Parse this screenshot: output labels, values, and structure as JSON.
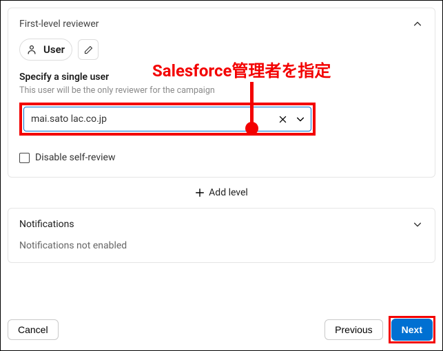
{
  "annotation": {
    "text": "Salesforce管理者を指定"
  },
  "reviewer_panel": {
    "title": "First-level reviewer",
    "pill_label": "User",
    "field_label": "Specify a single user",
    "field_help": "This user will be the only reviewer for the campaign",
    "selected_user": "mai.sato lac.co.jp",
    "disable_self_review_label": "Disable self-review"
  },
  "add_level_label": "Add level",
  "notifications": {
    "title": "Notifications",
    "status": "Notifications not enabled"
  },
  "footer": {
    "cancel": "Cancel",
    "previous": "Previous",
    "next": "Next"
  }
}
